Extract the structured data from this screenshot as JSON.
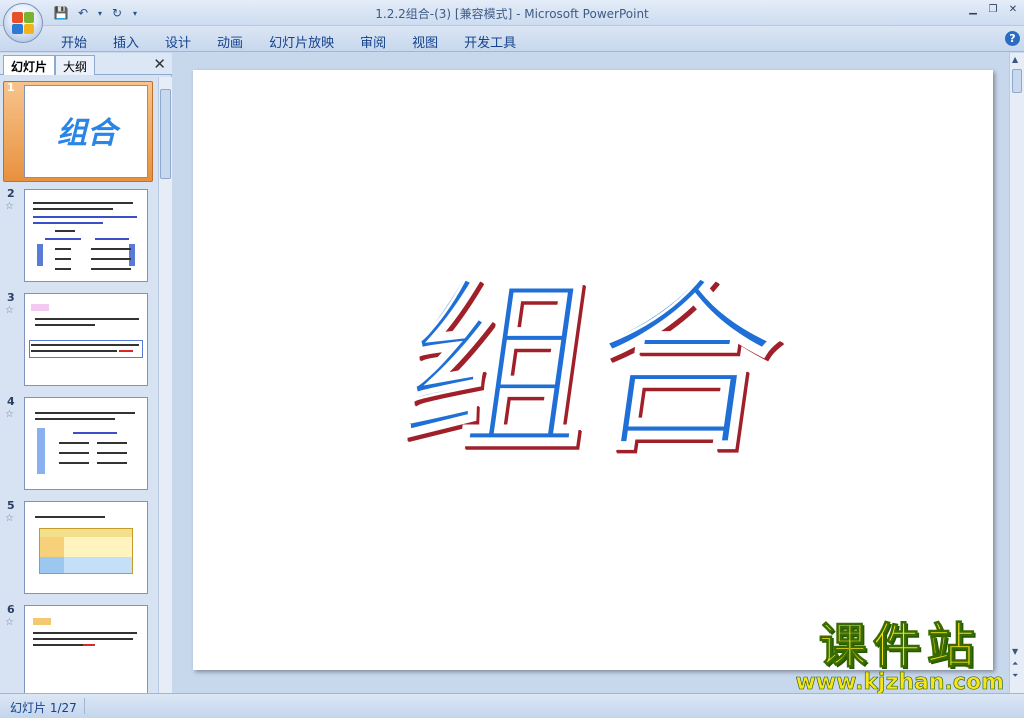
{
  "window": {
    "title": "1.2.2组合-(3) [兼容模式] - Microsoft PowerPoint"
  },
  "ribbon": {
    "tabs": [
      "开始",
      "插入",
      "设计",
      "动画",
      "幻灯片放映",
      "审阅",
      "视图",
      "开发工具"
    ]
  },
  "left_pane": {
    "tabs": [
      "幻灯片",
      "大纲"
    ],
    "close": "✕",
    "slides": [
      {
        "num": "1",
        "title": "组合"
      },
      {
        "num": "2"
      },
      {
        "num": "3"
      },
      {
        "num": "4"
      },
      {
        "num": "5"
      },
      {
        "num": "6"
      }
    ]
  },
  "slide": {
    "title": "组合"
  },
  "watermark": {
    "name": "课件站",
    "url": "www.kjzhan.com"
  },
  "status": {
    "slide_counter": "幻灯片 1/27"
  },
  "colors": {
    "title_blue": "#1f6fd6",
    "title_shadow": "#a0202a",
    "selected_thumb": "#e8913e",
    "watermark_yellow": "#f6e41e"
  }
}
